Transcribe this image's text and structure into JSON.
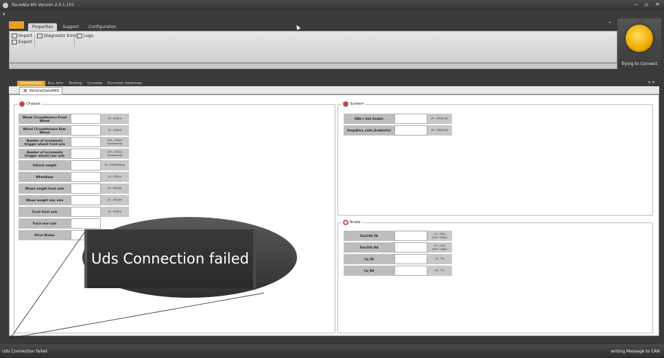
{
  "window": {
    "title": "RaceAbs M5 Version 2.0.1.101",
    "controls": [
      "‒",
      "▫",
      "✕"
    ]
  },
  "qat": {
    "menu_glyph": "▾"
  },
  "ribbon": {
    "file_label": "",
    "tabs": [
      "Properties",
      "Support",
      "Configuration"
    ],
    "collapse_glyph": "^",
    "buttons": {
      "import": "Import",
      "export": "Export",
      "diag": "Diagnostic Errors",
      "logs": "Logs"
    }
  },
  "connection": {
    "status": "Trying to Connect"
  },
  "doc": {
    "tabs": [
      "VehicleData",
      "Ecu Info",
      "Testing",
      "Console",
      "Function Switches"
    ],
    "controls": "▾ ✕",
    "subtab": "VehicleDataABS"
  },
  "chassis": {
    "title": "Chassis",
    "rows": [
      {
        "label": "Wheel Circumference Front Wheel",
        "range": "[0...10](m)"
      },
      {
        "label": "Wheel Circumference Rear Wheel",
        "range": "[0...10](m)"
      },
      {
        "label": "Number of increments (trigger wheel) front axle",
        "range": "[25...100](1 Increament)"
      },
      {
        "label": "Number of increments (trigger wheel) rear axle",
        "range": "[25...100](1 Increament)"
      },
      {
        "label": "Vehicle weight",
        "range": "[0...100000](kg)"
      },
      {
        "label": "Wheelbase",
        "range": "[0...10](m)"
      },
      {
        "label": "Wheel weight front axle",
        "range": "[0...50](kg)"
      },
      {
        "label": "Wheel weight rear axle",
        "range": "[0...50](kg)"
      },
      {
        "label": "Track front axle",
        "range": "[0...10](m)"
      },
      {
        "label": "Track rear axle",
        "range": ""
      },
      {
        "label": "Drive Modus",
        "range": ""
      }
    ]
  },
  "system": {
    "title": "System",
    "rows": [
      {
        "label": "EBD v Veh Enable",
        "range": "[0...100](m/s)"
      },
      {
        "label": "KeepAlive_vVeh_EnableCtrl",
        "range": "[0...100](m/s)"
      }
    ]
  },
  "brake": {
    "title": "Brake",
    "rows": [
      {
        "label": "Elas100_FA",
        "range": "[0...100](mm^2/bar)"
      },
      {
        "label": "Elas100_RA",
        "range": "[0...100](mm^2/bar)"
      },
      {
        "label": "Cp_FA",
        "range": "[0...75]"
      },
      {
        "label": "Cp_RA",
        "range": "[0...75]"
      }
    ]
  },
  "popup": {
    "message": "Uds Connection failed"
  },
  "statusbar": {
    "left": "Uds Connection failed",
    "right": "writing Message to CAN"
  },
  "colors": {
    "accent": "#e8a020",
    "lamp": "#f0a800",
    "error": "#dd2222"
  }
}
